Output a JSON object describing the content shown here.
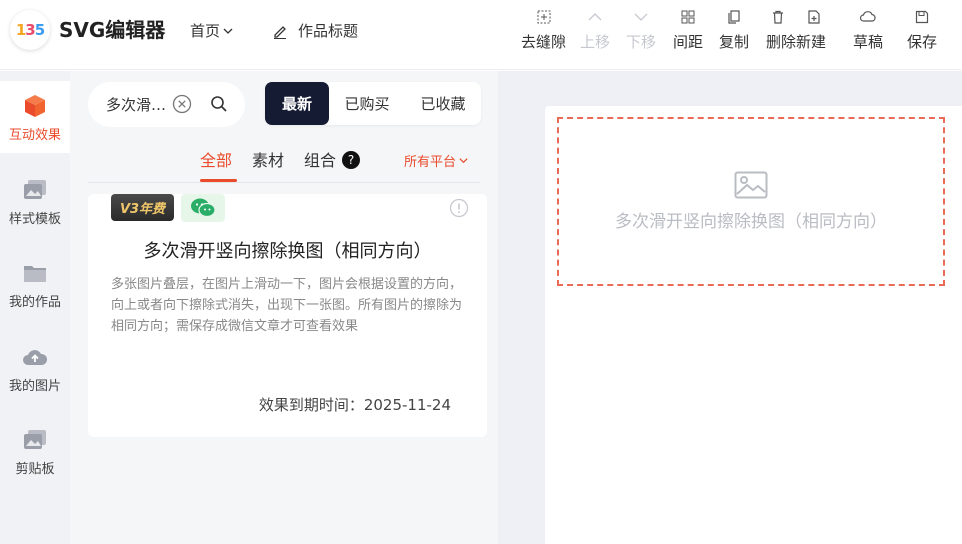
{
  "header": {
    "logo_text": "135",
    "app_title": "SVG编辑器",
    "home_menu": "首页",
    "work_title": "作品标题"
  },
  "toolbar": [
    {
      "label": "去缝隙",
      "icon": "gap-icon",
      "disabled": false
    },
    {
      "label": "上移",
      "icon": "arrow-up-icon",
      "disabled": true
    },
    {
      "label": "下移",
      "icon": "arrow-down-icon",
      "disabled": true
    },
    {
      "label": "间距",
      "icon": "spacing-icon",
      "disabled": false
    },
    {
      "label": "复制",
      "icon": "copy-icon",
      "disabled": false
    },
    {
      "label": "删除新建",
      "icon": "trash-icon",
      "disabled": false
    },
    {
      "label": "草稿",
      "icon": "cloud-icon",
      "disabled": false
    },
    {
      "label": "保存",
      "icon": "save-icon",
      "disabled": false
    }
  ],
  "sidebar": {
    "items": [
      {
        "label": "互动效果",
        "icon": "cube-icon",
        "active": true
      },
      {
        "label": "样式模板",
        "icon": "template-icon",
        "active": false
      },
      {
        "label": "我的作品",
        "icon": "folder-icon",
        "active": false
      },
      {
        "label": "我的图片",
        "icon": "cloud-upload-icon",
        "active": false
      },
      {
        "label": "剪贴板",
        "icon": "clipboard-icon",
        "active": false
      }
    ]
  },
  "search": {
    "value": "多次滑开竖向擦除换图"
  },
  "sort": {
    "options": [
      "最新",
      "已购买",
      "已收藏"
    ],
    "selected": "最新"
  },
  "tabs": {
    "items": [
      "全部",
      "素材",
      "组合"
    ],
    "active": "全部",
    "help_mark": "?",
    "platform": "所有平台"
  },
  "card": {
    "badge": "V3年费",
    "title": "多次滑开竖向擦除换图（相同方向）",
    "description": "多张图片叠层，在图片上滑动一下，图片会根据设置的方向，向上或者向下擦除式消失，出现下一张图。所有图片的擦除为相同方向；需保存成微信文章才可查看效果",
    "expire_label": "效果到期时间：2025-11-24"
  },
  "canvas": {
    "placeholder_text": "多次滑开竖向擦除换图（相同方向）"
  },
  "colors": {
    "accent": "#e94b2b",
    "dark_button": "#141b33",
    "dashed_border": "#e96a55"
  }
}
